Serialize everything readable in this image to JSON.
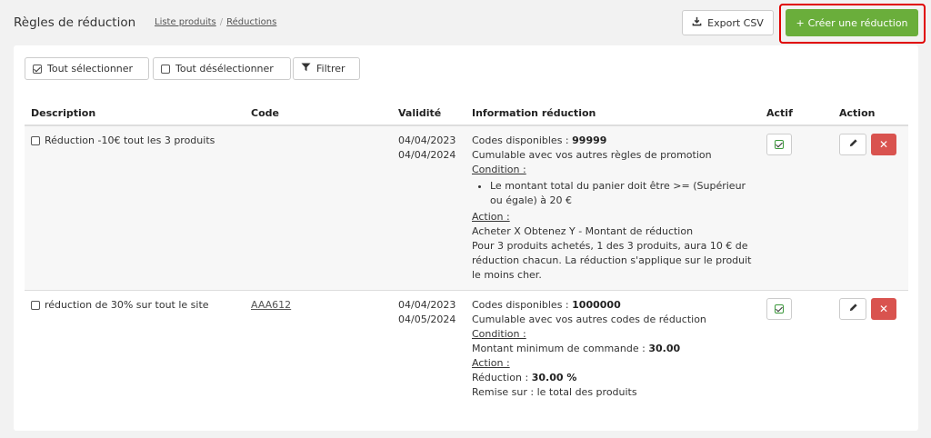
{
  "header": {
    "title": "Règles de réduction",
    "breadcrumb": [
      "Liste produits",
      "Réductions"
    ],
    "export_label": "Export CSV",
    "create_label": "Créer une réduction"
  },
  "toolbar": {
    "select_all": "Tout sélectionner",
    "deselect_all": "Tout désélectionner",
    "filter": "Filtrer"
  },
  "table": {
    "columns": [
      "Description",
      "Code",
      "Validité",
      "Information réduction",
      "Actif",
      "Action"
    ],
    "rows": [
      {
        "description": "Réduction -10€ tout les 3 produits",
        "code": "",
        "valid_from": "04/04/2023",
        "valid_to": "04/04/2024",
        "codes_label": "Codes disponibles : ",
        "codes_value": "99999",
        "cumul": "Cumulable avec vos autres règles de promotion",
        "condition_label": "Condition :",
        "condition_item": "Le montant total du panier doit être >= (Supérieur ou égale) à 20 €",
        "action_label": "Action :",
        "action_type": "Acheter X Obtenez Y - Montant de réduction",
        "action_detail": "Pour 3 produits achetés, 1 des 3 produits, aura 10 € de réduction chacun. La réduction s'applique sur le produit le moins cher."
      },
      {
        "description": "réduction de 30% sur tout le site",
        "code": "AAA612",
        "valid_from": "04/04/2023",
        "valid_to": "04/05/2024",
        "codes_label": "Codes disponibles : ",
        "codes_value": "1000000",
        "cumul": "Cumulable avec vos autres codes de réduction",
        "condition_label": "Condition :",
        "condition_text": "Montant minimum de commande : ",
        "condition_value": "30.00",
        "action_label": "Action :",
        "reduction_text": "Réduction : ",
        "reduction_value": "30.00 %",
        "remise": "Remise sur : le total des produits"
      }
    ]
  },
  "colors": {
    "accent_green": "#6aae3b",
    "delete_red": "#d9534f",
    "highlight_red": "#e00000",
    "active_green": "#3c9a3c"
  },
  "icons": {
    "export": "download-icon",
    "create": "plus-icon",
    "filter": "funnel-icon",
    "edit": "pencil-icon",
    "delete": "close-icon",
    "active": "check-square-icon"
  }
}
